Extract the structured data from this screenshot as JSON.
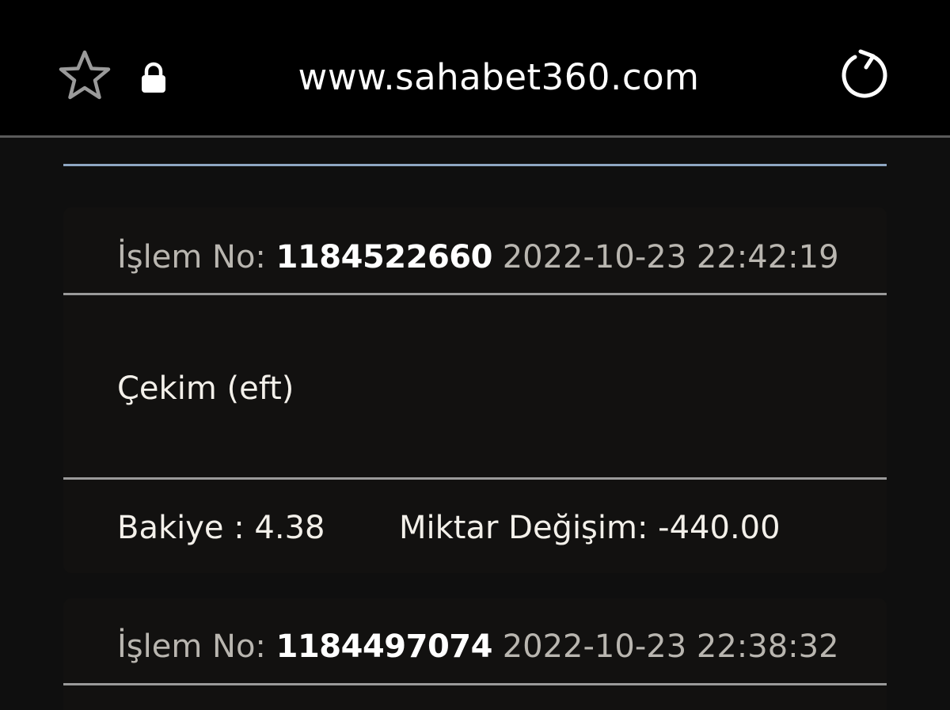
{
  "browser": {
    "url": "www.sahabet360.com",
    "icons": [
      "star-icon",
      "lock-icon",
      "reload-icon"
    ]
  },
  "transactions": [
    {
      "label": "İşlem No:",
      "number": "1184522660",
      "datetime": "2022-10-23 22:42:19",
      "type": "Çekim (eft)",
      "balance_text": "Bakiye : 4.38",
      "change_text": "Miktar Değişim: -440.00"
    },
    {
      "label": "İşlem No:",
      "number": "1184497074",
      "datetime": "2022-10-23 22:38:32"
    }
  ],
  "colors": {
    "background": "#0f0f0f",
    "bar": "#000000",
    "accent_line": "#8ea6c2",
    "text_primary": "#ffffff",
    "text_muted": "#b9b6b0"
  }
}
